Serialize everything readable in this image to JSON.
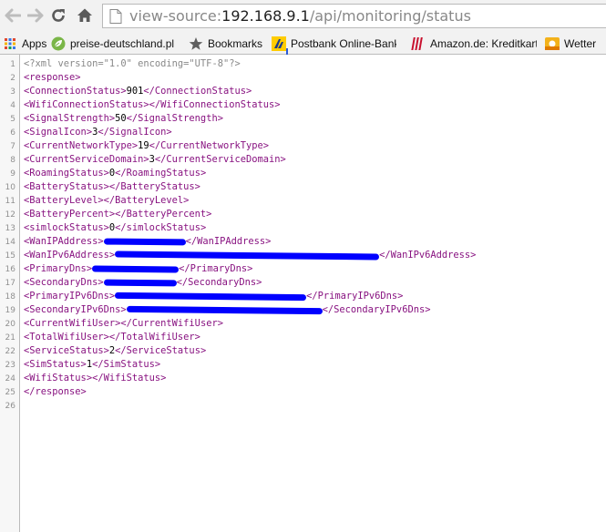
{
  "browser": {
    "url_prefix": "view-source:",
    "url_host": "192.168.9.1",
    "url_path": "/api/monitoring/status",
    "icons": [
      "back-arrow-icon",
      "forward-arrow-icon",
      "reload-icon",
      "home-icon",
      "page-icon"
    ]
  },
  "bookmarks": [
    {
      "label": "Apps",
      "icon": "apps-grid-icon"
    },
    {
      "label": "preise-deutschland.pl",
      "icon": "leaf-favicon-icon"
    },
    {
      "label": "Bookmarks",
      "icon": "star-icon"
    },
    {
      "label": "Postbank Online-Bank",
      "icon": "postbank-favicon-icon"
    },
    {
      "label": "Amazon.de: Kreditkart",
      "icon": "amazon-favicon-icon"
    },
    {
      "label": "Wetter",
      "icon": "weather-favicon-icon"
    }
  ],
  "source": {
    "line_numbers": [
      "1",
      "2",
      "3",
      "4",
      "5",
      "6",
      "7",
      "8",
      "9",
      "10",
      "11",
      "12",
      "13",
      "14",
      "15",
      "16",
      "17",
      "18",
      "19",
      "20",
      "21",
      "22",
      "23",
      "24",
      "25",
      "26"
    ],
    "xml_declaration": "<?xml version=\"1.0\" encoding=\"UTF-8\"?>",
    "root_open": "<response>",
    "root_close": "</response>",
    "elements": [
      {
        "tag": "ConnectionStatus",
        "value": "901"
      },
      {
        "tag": "WifiConnectionStatus",
        "value": ""
      },
      {
        "tag": "SignalStrength",
        "value": "50"
      },
      {
        "tag": "SignalIcon",
        "value": "3"
      },
      {
        "tag": "CurrentNetworkType",
        "value": "19"
      },
      {
        "tag": "CurrentServiceDomain",
        "value": "3"
      },
      {
        "tag": "RoamingStatus",
        "value": "0"
      },
      {
        "tag": "BatteryStatus",
        "value": ""
      },
      {
        "tag": "BatteryLevel",
        "value": ""
      },
      {
        "tag": "BatteryPercent",
        "value": ""
      },
      {
        "tag": "simlockStatus",
        "value": "0"
      },
      {
        "tag": "WanIPAddress",
        "value": "",
        "redacted": true
      },
      {
        "tag": "WanIPv6Address",
        "value": "",
        "redacted": true
      },
      {
        "tag": "PrimaryDns",
        "value": "",
        "redacted": true
      },
      {
        "tag": "SecondaryDns",
        "value": "",
        "redacted": true
      },
      {
        "tag": "PrimaryIPv6Dns",
        "value": "",
        "redacted": true
      },
      {
        "tag": "SecondaryIPv6Dns",
        "value": "",
        "redacted": true
      },
      {
        "tag": "CurrentWifiUser",
        "value": ""
      },
      {
        "tag": "TotalWifiUser",
        "value": ""
      },
      {
        "tag": "ServiceStatus",
        "value": "2"
      },
      {
        "tag": "SimStatus",
        "value": "1"
      },
      {
        "tag": "WifiStatus",
        "value": ""
      }
    ],
    "redaction_color": "#0000ff",
    "tag_color": "#881280"
  }
}
